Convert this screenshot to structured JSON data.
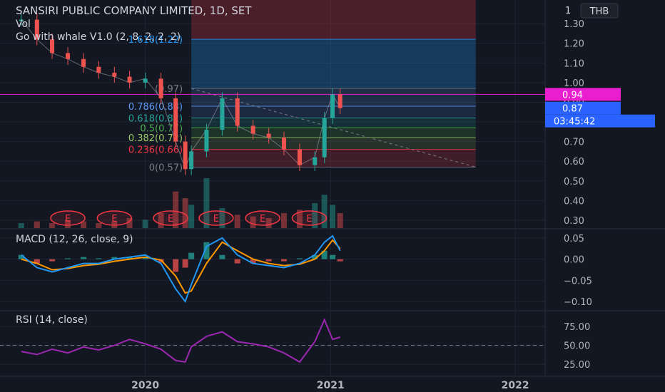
{
  "header": {
    "title": "SANSIRI PUBLIC COMPANY LIMITED, 1D, SET",
    "line2": "Vol",
    "line3": "Go with whale V1.0 (2, 8, 2, 2, 2)",
    "currency": "THB",
    "top_tick": "1"
  },
  "colors": {
    "background": "#131722",
    "grid": "#1f2430",
    "text": "#d1d4dc",
    "candle_up": "#26a69a",
    "candle_down": "#ef5350",
    "macd_line": "#2196f3",
    "signal_line": "#ff9800",
    "rsi_line": "#9c27b0",
    "price_label": "#2962ff",
    "alert_label": "#e91ecf"
  },
  "chart_data": [
    {
      "type": "candlestick",
      "name": "price",
      "x_dates": [
        "2019-05-01",
        "2019-06-01",
        "2019-07-01",
        "2019-08-01",
        "2019-09-01",
        "2019-10-01",
        "2019-11-01",
        "2019-12-01",
        "2020-01-01",
        "2020-02-01",
        "2020-03-01",
        "2020-03-20",
        "2020-04-01",
        "2020-05-01",
        "2020-06-01",
        "2020-07-01",
        "2020-08-01",
        "2020-09-01",
        "2020-10-01",
        "2020-11-01",
        "2020-12-01",
        "2020-12-20",
        "2021-01-05",
        "2021-01-20"
      ],
      "close": [
        1.32,
        1.22,
        1.15,
        1.12,
        1.08,
        1.05,
        1.03,
        1.0,
        1.02,
        0.92,
        0.7,
        0.56,
        0.65,
        0.76,
        0.92,
        0.78,
        0.74,
        0.72,
        0.66,
        0.58,
        0.62,
        0.82,
        0.94,
        0.87
      ],
      "y_ticks": [
        "0.30",
        "0.40",
        "0.50",
        "0.60",
        "0.70",
        "0.80",
        "0.90",
        "1.00",
        "1.10",
        "1.20",
        "1.30"
      ],
      "ylim": [
        0.26,
        1.42
      ],
      "fib_levels": [
        {
          "label": "1.618(1.22)",
          "value": 1.22,
          "color": "#2196f3"
        },
        {
          "label": "(0.97)",
          "value": 0.97,
          "color": "#787b86"
        },
        {
          "label": "0.786(0.88)",
          "value": 0.88,
          "color": "#5b9cf6"
        },
        {
          "label": "0.618(0.82)",
          "value": 0.82,
          "color": "#26a69a"
        },
        {
          "label": "0.5(0.77)",
          "value": 0.77,
          "color": "#4caf50"
        },
        {
          "label": "0.382(0.72)",
          "value": 0.72,
          "color": "#9ccc65"
        },
        {
          "label": "0.236(0.66)",
          "value": 0.66,
          "color": "#f23645"
        },
        {
          "label": "0(0.57)",
          "value": 0.57,
          "color": "#787b86"
        }
      ],
      "last_price_label": "0.87",
      "countdown_label": "03:45:42",
      "alert_price_label": "0.94",
      "alert_value": 0.94,
      "earnings_marker": "E",
      "earnings_dates": [
        "2019-08-01",
        "2019-11-01",
        "2020-02-20",
        "2020-05-20",
        "2020-08-20",
        "2020-11-20"
      ],
      "volume_values": [
        3,
        4,
        3,
        5,
        4,
        3,
        4,
        6,
        5,
        9,
        22,
        18,
        14,
        30,
        12,
        8,
        7,
        6,
        9,
        11,
        15,
        20,
        14,
        9
      ]
    },
    {
      "type": "line",
      "name": "MACD",
      "title": "MACD (12, 26, close, 9)",
      "x_dates": [
        "2019-05-01",
        "2019-06-01",
        "2019-07-01",
        "2019-08-01",
        "2019-09-01",
        "2019-10-01",
        "2019-11-01",
        "2019-12-01",
        "2020-01-01",
        "2020-02-01",
        "2020-03-01",
        "2020-03-20",
        "2020-04-01",
        "2020-05-01",
        "2020-06-01",
        "2020-07-01",
        "2020-08-01",
        "2020-09-01",
        "2020-10-01",
        "2020-11-01",
        "2020-12-01",
        "2020-12-20",
        "2021-01-05",
        "2021-01-20"
      ],
      "macd": [
        0.01,
        -0.02,
        -0.03,
        -0.02,
        -0.01,
        -0.01,
        0.0,
        0.005,
        0.01,
        -0.01,
        -0.07,
        -0.1,
        -0.06,
        0.03,
        0.05,
        0.01,
        -0.01,
        -0.015,
        -0.02,
        -0.01,
        0.01,
        0.04,
        0.055,
        0.02
      ],
      "signal": [
        0.0,
        -0.01,
        -0.025,
        -0.022,
        -0.015,
        -0.012,
        -0.005,
        0.0,
        0.005,
        -0.002,
        -0.04,
        -0.08,
        -0.075,
        -0.01,
        0.04,
        0.02,
        0.0,
        -0.01,
        -0.015,
        -0.012,
        0.0,
        0.02,
        0.045,
        0.025
      ],
      "y_ticks": [
        "0.05",
        "0.00",
        "−0.05",
        "−0.10"
      ],
      "ylim": [
        -0.12,
        0.07
      ]
    },
    {
      "type": "line",
      "name": "RSI",
      "title": "RSI (14, close)",
      "x_dates": [
        "2019-05-01",
        "2019-06-01",
        "2019-07-01",
        "2019-08-01",
        "2019-09-01",
        "2019-10-01",
        "2019-11-01",
        "2019-12-01",
        "2020-01-01",
        "2020-02-01",
        "2020-03-01",
        "2020-03-20",
        "2020-04-01",
        "2020-05-01",
        "2020-06-01",
        "2020-07-01",
        "2020-08-01",
        "2020-09-01",
        "2020-10-01",
        "2020-11-01",
        "2020-12-01",
        "2020-12-20",
        "2021-01-05",
        "2021-01-20"
      ],
      "values": [
        42,
        38,
        45,
        40,
        48,
        44,
        50,
        58,
        52,
        45,
        30,
        28,
        48,
        62,
        68,
        55,
        52,
        48,
        40,
        28,
        55,
        84,
        58,
        61
      ],
      "y_ticks": [
        "75.00",
        "50.00",
        "25.00"
      ],
      "ylim": [
        10,
        95
      ],
      "reference": 50
    }
  ],
  "x_axis": {
    "start": "2019-03-20",
    "end": "2022-03-01",
    "labels": [
      {
        "text": "2020",
        "date": "2020-01-01"
      },
      {
        "text": "2021",
        "date": "2021-01-01"
      },
      {
        "text": "2022",
        "date": "2022-01-01"
      }
    ]
  }
}
